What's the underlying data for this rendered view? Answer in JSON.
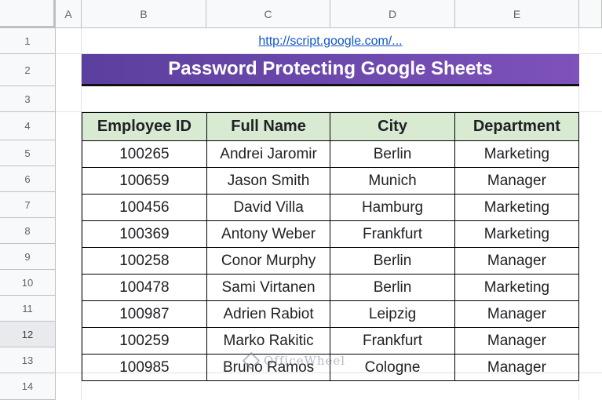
{
  "columns": [
    "A",
    "B",
    "C",
    "D",
    "E"
  ],
  "rows": [
    "1",
    "2",
    "3",
    "4",
    "5",
    "6",
    "7",
    "8",
    "9",
    "10",
    "11",
    "12",
    "13",
    "14"
  ],
  "link": "http://script.google.com/...",
  "title": "Password Protecting Google Sheets",
  "table": {
    "headers": [
      "Employee ID",
      "Full Name",
      "City",
      "Department"
    ],
    "rows": [
      [
        "100265",
        "Andrei Jaromir",
        "Berlin",
        "Marketing"
      ],
      [
        "100659",
        "Jason Smith",
        "Munich",
        "Manager"
      ],
      [
        "100456",
        "David Villa",
        "Hamburg",
        "Marketing"
      ],
      [
        "100369",
        "Antony Weber",
        "Frankfurt",
        "Marketing"
      ],
      [
        "100258",
        "Conor Murphy",
        "Berlin",
        "Manager"
      ],
      [
        "100478",
        "Sami Virtanen",
        "Berlin",
        "Marketing"
      ],
      [
        "100987",
        "Adrien Rabiot",
        "Leipzig",
        "Manager"
      ],
      [
        "100259",
        "Marko Rakitic",
        "Frankfurt",
        "Manager"
      ],
      [
        "100985",
        "Bruno Ramos",
        "Cologne",
        "Manager"
      ]
    ]
  },
  "watermark": "OfficeWheel",
  "colors": {
    "title_bg_start": "#5b3f9e",
    "title_bg_end": "#7d52bb",
    "header_fill": "#d9ead3",
    "link": "#1155cc"
  }
}
